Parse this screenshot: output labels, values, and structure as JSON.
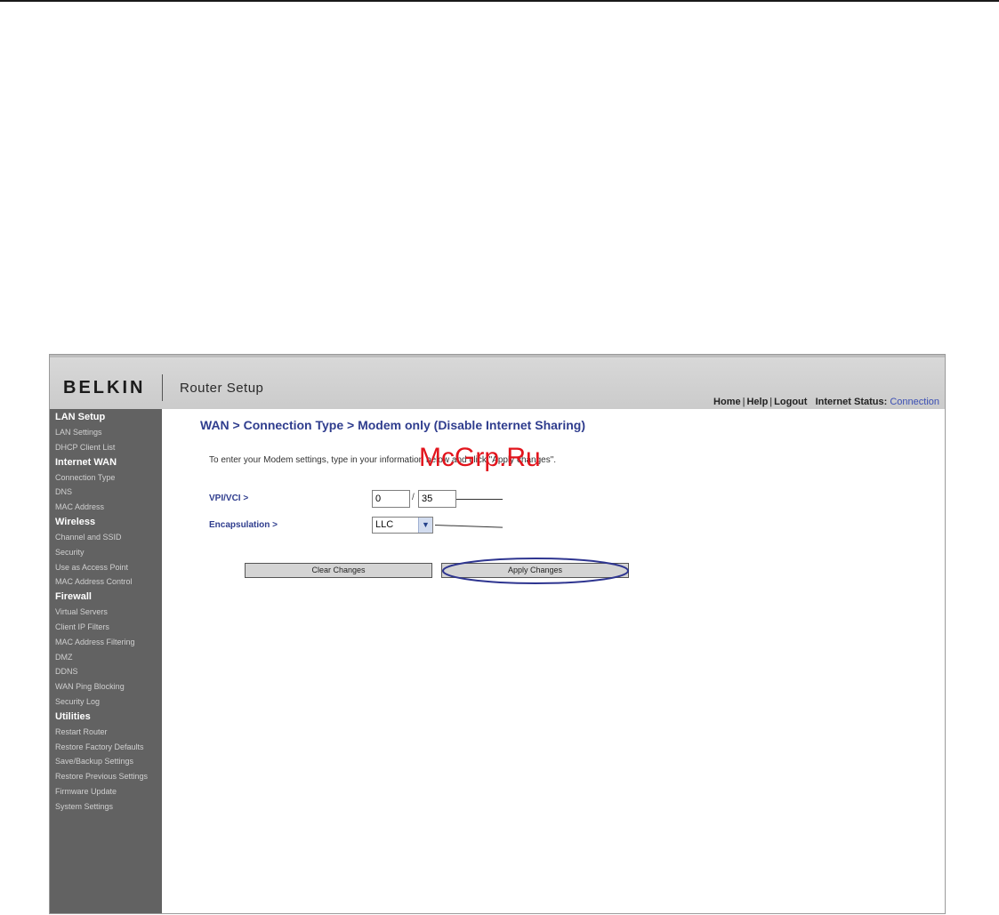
{
  "watermark": "McGrp.Ru",
  "header": {
    "brand": "BELKIN",
    "app_title": "Router Setup",
    "links": {
      "home": "Home",
      "help": "Help",
      "logout": "Logout",
      "separator": "|",
      "status_label": "Internet Status:",
      "status_value": "Connection"
    }
  },
  "sidebar": {
    "sections": [
      {
        "title": "LAN Setup",
        "items": [
          "LAN Settings",
          "DHCP Client List"
        ]
      },
      {
        "title": "Internet WAN",
        "items": [
          "Connection Type",
          "DNS",
          "MAC Address"
        ]
      },
      {
        "title": "Wireless",
        "items": [
          "Channel and SSID",
          "Security",
          "Use as Access Point",
          "MAC Address Control"
        ]
      },
      {
        "title": "Firewall",
        "items": [
          "Virtual Servers",
          "Client IP Filters",
          "MAC Address Filtering",
          "DMZ",
          "DDNS",
          "WAN Ping Blocking",
          "Security Log"
        ]
      },
      {
        "title": "Utilities",
        "items": [
          "Restart Router",
          "Restore Factory Defaults",
          "Save/Backup Settings",
          "Restore Previous Settings",
          "Firmware Update",
          "System Settings"
        ]
      }
    ]
  },
  "main": {
    "title": "WAN > Connection Type > Modem only (Disable Internet Sharing)",
    "instructions": "To enter your Modem settings, type in your information below and click \"Apply changes\".",
    "vpi_label": "VPI/VCI >",
    "vpi_value": "0",
    "vpi_separator": "/",
    "vci_value": "35",
    "encap_label": "Encapsulation >",
    "encap_value": "LLC",
    "clear_button": "Clear Changes",
    "apply_button": "Apply Changes"
  },
  "colors": {
    "heading_blue": "#2f3d8e",
    "sidebar_bg": "#626262",
    "header_bg": "#cbcbcb",
    "watermark_red": "#e2141c",
    "oval_blue": "#2e3590"
  }
}
